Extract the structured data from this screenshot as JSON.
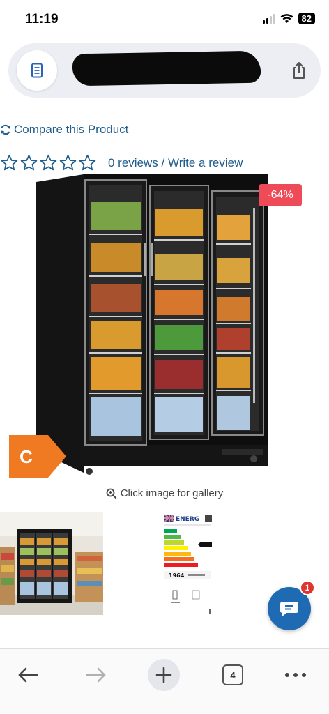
{
  "status_bar": {
    "time": "11:19",
    "battery": "82",
    "icons": [
      "signal-icon",
      "wifi-icon",
      "battery-icon"
    ]
  },
  "browser": {
    "reader_icon": "reader-mode-icon",
    "share_icon": "share-icon"
  },
  "product": {
    "compare_label": "Compare this Product",
    "rating": {
      "value": 0,
      "max": 5
    },
    "reviews_text": "0 reviews / Write a review",
    "discount": "-64%",
    "energy_class": "C",
    "gallery_hint": "Click image for gallery",
    "energy_label": {
      "title": "ENERG",
      "value": "1964"
    }
  },
  "chat": {
    "badge_count": "1"
  },
  "bottom_bar": {
    "tab_count": "4",
    "items": [
      "back-icon",
      "forward-icon",
      "new-tab-icon",
      "tabs-icon",
      "more-icon"
    ]
  },
  "colors": {
    "link": "#1e5d8c",
    "discount": "#ee4a57",
    "energy_tag": "#f07a22",
    "chat": "#1f6bb3",
    "badge": "#e0352f"
  }
}
